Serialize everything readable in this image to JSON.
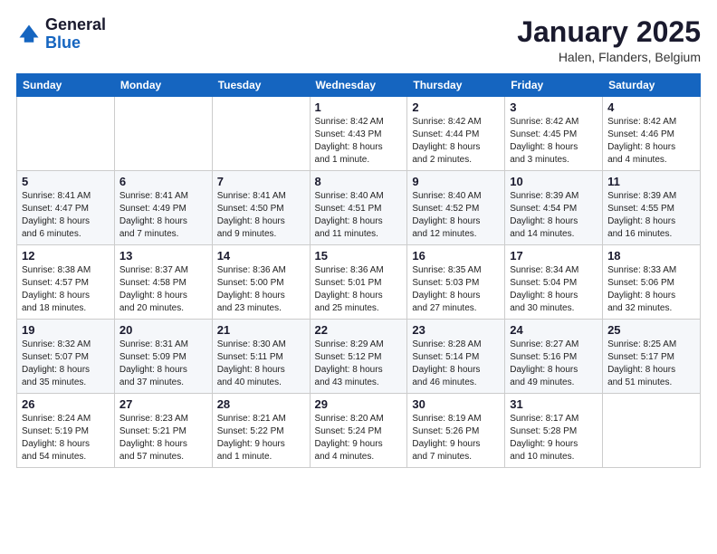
{
  "logo": {
    "general": "General",
    "blue": "Blue"
  },
  "header": {
    "title": "January 2025",
    "location": "Halen, Flanders, Belgium"
  },
  "days_of_week": [
    "Sunday",
    "Monday",
    "Tuesday",
    "Wednesday",
    "Thursday",
    "Friday",
    "Saturday"
  ],
  "weeks": [
    [
      {
        "day": "",
        "info": ""
      },
      {
        "day": "",
        "info": ""
      },
      {
        "day": "",
        "info": ""
      },
      {
        "day": "1",
        "info": "Sunrise: 8:42 AM\nSunset: 4:43 PM\nDaylight: 8 hours\nand 1 minute."
      },
      {
        "day": "2",
        "info": "Sunrise: 8:42 AM\nSunset: 4:44 PM\nDaylight: 8 hours\nand 2 minutes."
      },
      {
        "day": "3",
        "info": "Sunrise: 8:42 AM\nSunset: 4:45 PM\nDaylight: 8 hours\nand 3 minutes."
      },
      {
        "day": "4",
        "info": "Sunrise: 8:42 AM\nSunset: 4:46 PM\nDaylight: 8 hours\nand 4 minutes."
      }
    ],
    [
      {
        "day": "5",
        "info": "Sunrise: 8:41 AM\nSunset: 4:47 PM\nDaylight: 8 hours\nand 6 minutes."
      },
      {
        "day": "6",
        "info": "Sunrise: 8:41 AM\nSunset: 4:49 PM\nDaylight: 8 hours\nand 7 minutes."
      },
      {
        "day": "7",
        "info": "Sunrise: 8:41 AM\nSunset: 4:50 PM\nDaylight: 8 hours\nand 9 minutes."
      },
      {
        "day": "8",
        "info": "Sunrise: 8:40 AM\nSunset: 4:51 PM\nDaylight: 8 hours\nand 11 minutes."
      },
      {
        "day": "9",
        "info": "Sunrise: 8:40 AM\nSunset: 4:52 PM\nDaylight: 8 hours\nand 12 minutes."
      },
      {
        "day": "10",
        "info": "Sunrise: 8:39 AM\nSunset: 4:54 PM\nDaylight: 8 hours\nand 14 minutes."
      },
      {
        "day": "11",
        "info": "Sunrise: 8:39 AM\nSunset: 4:55 PM\nDaylight: 8 hours\nand 16 minutes."
      }
    ],
    [
      {
        "day": "12",
        "info": "Sunrise: 8:38 AM\nSunset: 4:57 PM\nDaylight: 8 hours\nand 18 minutes."
      },
      {
        "day": "13",
        "info": "Sunrise: 8:37 AM\nSunset: 4:58 PM\nDaylight: 8 hours\nand 20 minutes."
      },
      {
        "day": "14",
        "info": "Sunrise: 8:36 AM\nSunset: 5:00 PM\nDaylight: 8 hours\nand 23 minutes."
      },
      {
        "day": "15",
        "info": "Sunrise: 8:36 AM\nSunset: 5:01 PM\nDaylight: 8 hours\nand 25 minutes."
      },
      {
        "day": "16",
        "info": "Sunrise: 8:35 AM\nSunset: 5:03 PM\nDaylight: 8 hours\nand 27 minutes."
      },
      {
        "day": "17",
        "info": "Sunrise: 8:34 AM\nSunset: 5:04 PM\nDaylight: 8 hours\nand 30 minutes."
      },
      {
        "day": "18",
        "info": "Sunrise: 8:33 AM\nSunset: 5:06 PM\nDaylight: 8 hours\nand 32 minutes."
      }
    ],
    [
      {
        "day": "19",
        "info": "Sunrise: 8:32 AM\nSunset: 5:07 PM\nDaylight: 8 hours\nand 35 minutes."
      },
      {
        "day": "20",
        "info": "Sunrise: 8:31 AM\nSunset: 5:09 PM\nDaylight: 8 hours\nand 37 minutes."
      },
      {
        "day": "21",
        "info": "Sunrise: 8:30 AM\nSunset: 5:11 PM\nDaylight: 8 hours\nand 40 minutes."
      },
      {
        "day": "22",
        "info": "Sunrise: 8:29 AM\nSunset: 5:12 PM\nDaylight: 8 hours\nand 43 minutes."
      },
      {
        "day": "23",
        "info": "Sunrise: 8:28 AM\nSunset: 5:14 PM\nDaylight: 8 hours\nand 46 minutes."
      },
      {
        "day": "24",
        "info": "Sunrise: 8:27 AM\nSunset: 5:16 PM\nDaylight: 8 hours\nand 49 minutes."
      },
      {
        "day": "25",
        "info": "Sunrise: 8:25 AM\nSunset: 5:17 PM\nDaylight: 8 hours\nand 51 minutes."
      }
    ],
    [
      {
        "day": "26",
        "info": "Sunrise: 8:24 AM\nSunset: 5:19 PM\nDaylight: 8 hours\nand 54 minutes."
      },
      {
        "day": "27",
        "info": "Sunrise: 8:23 AM\nSunset: 5:21 PM\nDaylight: 8 hours\nand 57 minutes."
      },
      {
        "day": "28",
        "info": "Sunrise: 8:21 AM\nSunset: 5:22 PM\nDaylight: 9 hours\nand 1 minute."
      },
      {
        "day": "29",
        "info": "Sunrise: 8:20 AM\nSunset: 5:24 PM\nDaylight: 9 hours\nand 4 minutes."
      },
      {
        "day": "30",
        "info": "Sunrise: 8:19 AM\nSunset: 5:26 PM\nDaylight: 9 hours\nand 7 minutes."
      },
      {
        "day": "31",
        "info": "Sunrise: 8:17 AM\nSunset: 5:28 PM\nDaylight: 9 hours\nand 10 minutes."
      },
      {
        "day": "",
        "info": ""
      }
    ]
  ]
}
